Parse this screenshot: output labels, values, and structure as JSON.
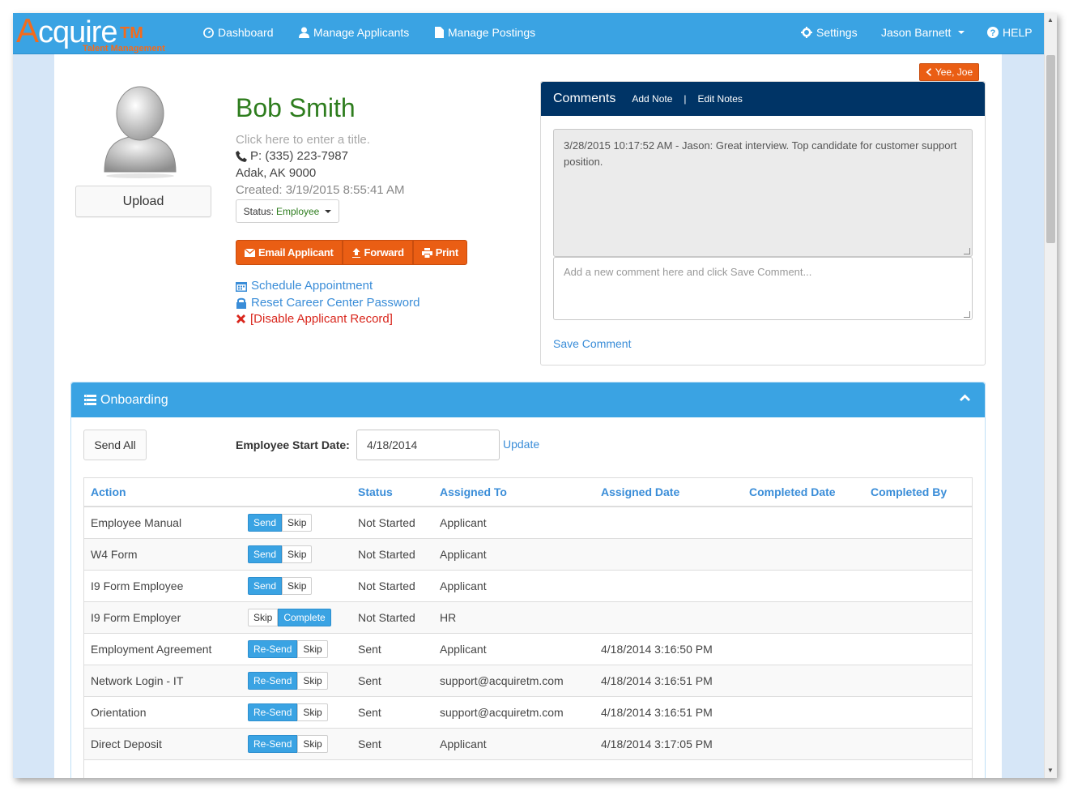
{
  "nav": {
    "logo_letter": "A",
    "logo_text": "cquire",
    "logo_tm": "TM",
    "logo_sub": "Talent Management",
    "dashboard": "Dashboard",
    "manage_applicants": "Manage Applicants",
    "manage_postings": "Manage Postings",
    "settings": "Settings",
    "user": "Jason Barnett",
    "help": "HELP"
  },
  "back_button": "Yee, Joe",
  "profile": {
    "upload_label": "Upload",
    "name": "Bob Smith",
    "title_placeholder": "Click here to enter a title.",
    "phone": "P: (335) 223-7987",
    "city": "Adak, AK 9000",
    "created": "Created: 3/19/2015 8:55:41 AM",
    "status_label": "Status:",
    "status_value": "Employee"
  },
  "actions": {
    "email": "Email Applicant",
    "forward": "Forward",
    "print": "Print",
    "schedule": "Schedule Appointment",
    "reset": "Reset Career Center Password",
    "disable": "[Disable Applicant Record]"
  },
  "comments": {
    "title": "Comments",
    "add_note": "Add Note",
    "separator": "|",
    "edit_notes": "Edit Notes",
    "existing": "3/28/2015 10:17:52 AM - Jason: Great interview. Top candidate for customer support position.",
    "new_placeholder": "Add a new comment here and click Save Comment...",
    "save": "Save Comment"
  },
  "onboarding": {
    "title": "Onboarding",
    "send_all": "Send All",
    "start_label": "Employee Start Date:",
    "start_value": "4/18/2014",
    "update": "Update",
    "headers": [
      "Action",
      "Status",
      "Assigned To",
      "Assigned Date",
      "Completed Date",
      "Completed By"
    ],
    "rows": [
      {
        "action": "Employee Manual",
        "buttons": [
          {
            "label": "Send",
            "primary": true
          },
          {
            "label": "Skip",
            "primary": false
          }
        ],
        "status": "Not Started",
        "assigned_to": "Applicant",
        "assigned_date": "",
        "completed_date": "",
        "completed_by": ""
      },
      {
        "action": "W4 Form",
        "buttons": [
          {
            "label": "Send",
            "primary": true
          },
          {
            "label": "Skip",
            "primary": false
          }
        ],
        "status": "Not Started",
        "assigned_to": "Applicant",
        "assigned_date": "",
        "completed_date": "",
        "completed_by": ""
      },
      {
        "action": "I9 Form Employee",
        "buttons": [
          {
            "label": "Send",
            "primary": true
          },
          {
            "label": "Skip",
            "primary": false
          }
        ],
        "status": "Not Started",
        "assigned_to": "Applicant",
        "assigned_date": "",
        "completed_date": "",
        "completed_by": ""
      },
      {
        "action": "I9 Form Employer",
        "buttons": [
          {
            "label": "Skip",
            "primary": false
          },
          {
            "label": "Complete",
            "primary": true
          }
        ],
        "status": "Not Started",
        "assigned_to": "HR",
        "assigned_date": "",
        "completed_date": "",
        "completed_by": ""
      },
      {
        "action": "Employment Agreement",
        "buttons": [
          {
            "label": "Re-Send",
            "primary": true
          },
          {
            "label": "Skip",
            "primary": false
          }
        ],
        "status": "Sent",
        "assigned_to": "Applicant",
        "assigned_date": "4/18/2014 3:16:50 PM",
        "completed_date": "",
        "completed_by": ""
      },
      {
        "action": "Network Login - IT",
        "buttons": [
          {
            "label": "Re-Send",
            "primary": true
          },
          {
            "label": "Skip",
            "primary": false
          }
        ],
        "status": "Sent",
        "assigned_to": "support@acquiretm.com",
        "assigned_date": "4/18/2014 3:16:51 PM",
        "completed_date": "",
        "completed_by": ""
      },
      {
        "action": "Orientation",
        "buttons": [
          {
            "label": "Re-Send",
            "primary": true
          },
          {
            "label": "Skip",
            "primary": false
          }
        ],
        "status": "Sent",
        "assigned_to": "support@acquiretm.com",
        "assigned_date": "4/18/2014 3:16:51 PM",
        "completed_date": "",
        "completed_by": ""
      },
      {
        "action": "Direct Deposit",
        "buttons": [
          {
            "label": "Re-Send",
            "primary": true
          },
          {
            "label": "Skip",
            "primary": false
          }
        ],
        "status": "Sent",
        "assigned_to": "Applicant",
        "assigned_date": "4/18/2014 3:17:05 PM",
        "completed_date": "",
        "completed_by": ""
      }
    ]
  },
  "colors": {
    "nav_blue": "#3aa3e3",
    "accent_orange": "#ea5e14",
    "comments_navy": "#003466",
    "name_green": "#2e7d1e",
    "link_blue": "#3a8dd8",
    "danger_red": "#d9261c"
  }
}
